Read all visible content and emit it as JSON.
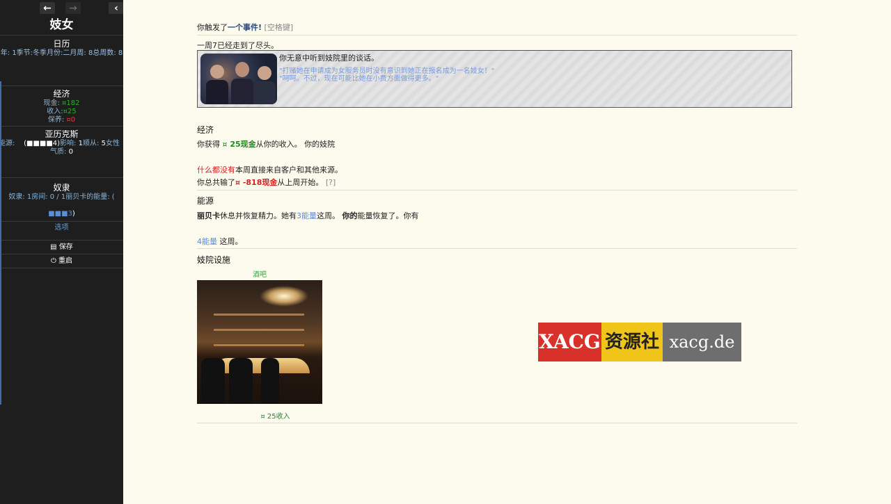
{
  "sidebar": {
    "nav": {
      "back_icon": "arrow-left",
      "forward_icon": "arrow-right",
      "collapse_icon": "chevron-left"
    },
    "title": "妓女",
    "calendar": {
      "heading": "日历",
      "line": "年: 1季节:冬季月份:二月周: 8总周数: 8"
    },
    "economy": {
      "heading": "经济",
      "cash_label": "现金:",
      "cash_value": "¤182",
      "income_label": "收入:",
      "income_value": "¤25",
      "upkeep_label": "保养:",
      "upkeep_value": "¤0"
    },
    "alexis": {
      "heading": "亚历克斯",
      "energy_label": "能源:",
      "energy_value": "(■■■■4)",
      "influence_label": "影响:",
      "influence_value": "1",
      "followers_label": "顺从:",
      "followers_value": "5",
      "gender": "女性",
      "temperament_label": "气质:",
      "temperament_value": "0"
    },
    "slaves": {
      "heading": "奴隶",
      "line1": "奴隶: 1房间: 0 / 1丽贝卡的能量: (",
      "line2_value": "■■■3",
      "line2_suffix": ")"
    },
    "options_label": "选项",
    "save_label": "保存",
    "restart_label": "重启"
  },
  "main": {
    "event_header_prefix": "你触发了",
    "event_header_link": "一个事件!",
    "event_header_hint": "[空格键]",
    "week_end": "一周7已经走到了尽头。",
    "event_box": {
      "text": "你无意中听到妓院里的谈话。",
      "quote1": "\"打赌她在申请成为女服务员时没有意识到她正在报名成为一名妓女！\"",
      "quote2": "\"呵呵。不过，现在可能比她在小费方面做得更多。\""
    },
    "economy": {
      "heading": "经济",
      "gain_prefix": "你获得 ",
      "gain_icon": "¤",
      "gain_value": " 25现金",
      "gain_suffix": "从你的收入。 你的妓院",
      "nothing_red": "什么都没有",
      "nothing_suffix": "本周直接来自客户和其他来源。",
      "lost_prefix": "你总共输了",
      "lost_value": "¤ -818现金",
      "lost_suffix": "从上周开始。",
      "lost_help": "[?]"
    },
    "energy": {
      "heading": "能源",
      "name": "丽贝卡",
      "rest_text": "休息并恢复精力。她有",
      "energy_amount": "3能量",
      "this_week": "这周。",
      "yours": "你的",
      "recovered": "能量恢复了。你有",
      "your_energy": "4能量",
      "this_week2": " 这周。"
    },
    "facilities": {
      "heading": "妓院设施",
      "bar_label": "酒吧",
      "bar_income": "¤ 25收入"
    }
  },
  "watermark": {
    "part1": "XACG",
    "part2": "资源社",
    "part3": "xacg.de"
  },
  "colors": {
    "sidebar_bg": "#1e1e1e",
    "page_bg": "#fdfbee",
    "link_blue": "#5a8ed6",
    "money_green": "#1f8a1f",
    "negative_red": "#d42020"
  }
}
